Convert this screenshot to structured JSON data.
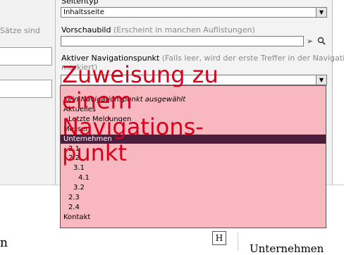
{
  "background": {
    "left_text": "Sätze sind",
    "heading_left": "n",
    "heading_right": "Unternehmen",
    "h_icon": "H"
  },
  "dialog": {
    "seitentyp_label": "Seitentyp",
    "seitentyp_value": "Inhaltsseite",
    "vorschaubild_label": "Vorschaubild",
    "vorschaubild_hint": "(Erscheint in manchen Auflistungen)",
    "vorschaubild_value": "",
    "nav_label": "Aktiver Navigationspunkt",
    "nav_hint_line1": "(Falls leer, wird der erste Treffer in der Navigation",
    "nav_hint_line2": "markiert)",
    "nav_value": ""
  },
  "dropdown": {
    "options": [
      {
        "label": "Kein Navigationspunkt ausgewählt",
        "level": 0,
        "italic": true,
        "selected": false
      },
      {
        "label": "Aktuelles",
        "level": 0,
        "italic": false,
        "selected": false
      },
      {
        "label": "Letzte Meldungen",
        "level": 1,
        "italic": false,
        "selected": false
      },
      {
        "label": "Messen",
        "level": 0,
        "italic": false,
        "selected": false
      },
      {
        "label": "Unternehmen",
        "level": 0,
        "italic": false,
        "selected": true
      },
      {
        "label": "2.1",
        "level": 1,
        "italic": false,
        "selected": false
      },
      {
        "label": "2.2",
        "level": 1,
        "italic": false,
        "selected": false
      },
      {
        "label": "3.1",
        "level": 2,
        "italic": false,
        "selected": false
      },
      {
        "label": "4.1",
        "level": 3,
        "italic": false,
        "selected": false
      },
      {
        "label": "3.2",
        "level": 2,
        "italic": false,
        "selected": false
      },
      {
        "label": "2.3",
        "level": 1,
        "italic": false,
        "selected": false
      },
      {
        "label": "2.4",
        "level": 1,
        "italic": false,
        "selected": false
      },
      {
        "label": "Kontakt",
        "level": 0,
        "italic": false,
        "selected": false
      }
    ]
  },
  "annotation": {
    "line1": "Zuweisung zu",
    "line2": "einem Navigations-",
    "line3": "punkt"
  },
  "colors": {
    "dropdown_bg": "#f7b8bf",
    "selected_bg": "#4a1f3e",
    "annotation": "#d9001c"
  }
}
